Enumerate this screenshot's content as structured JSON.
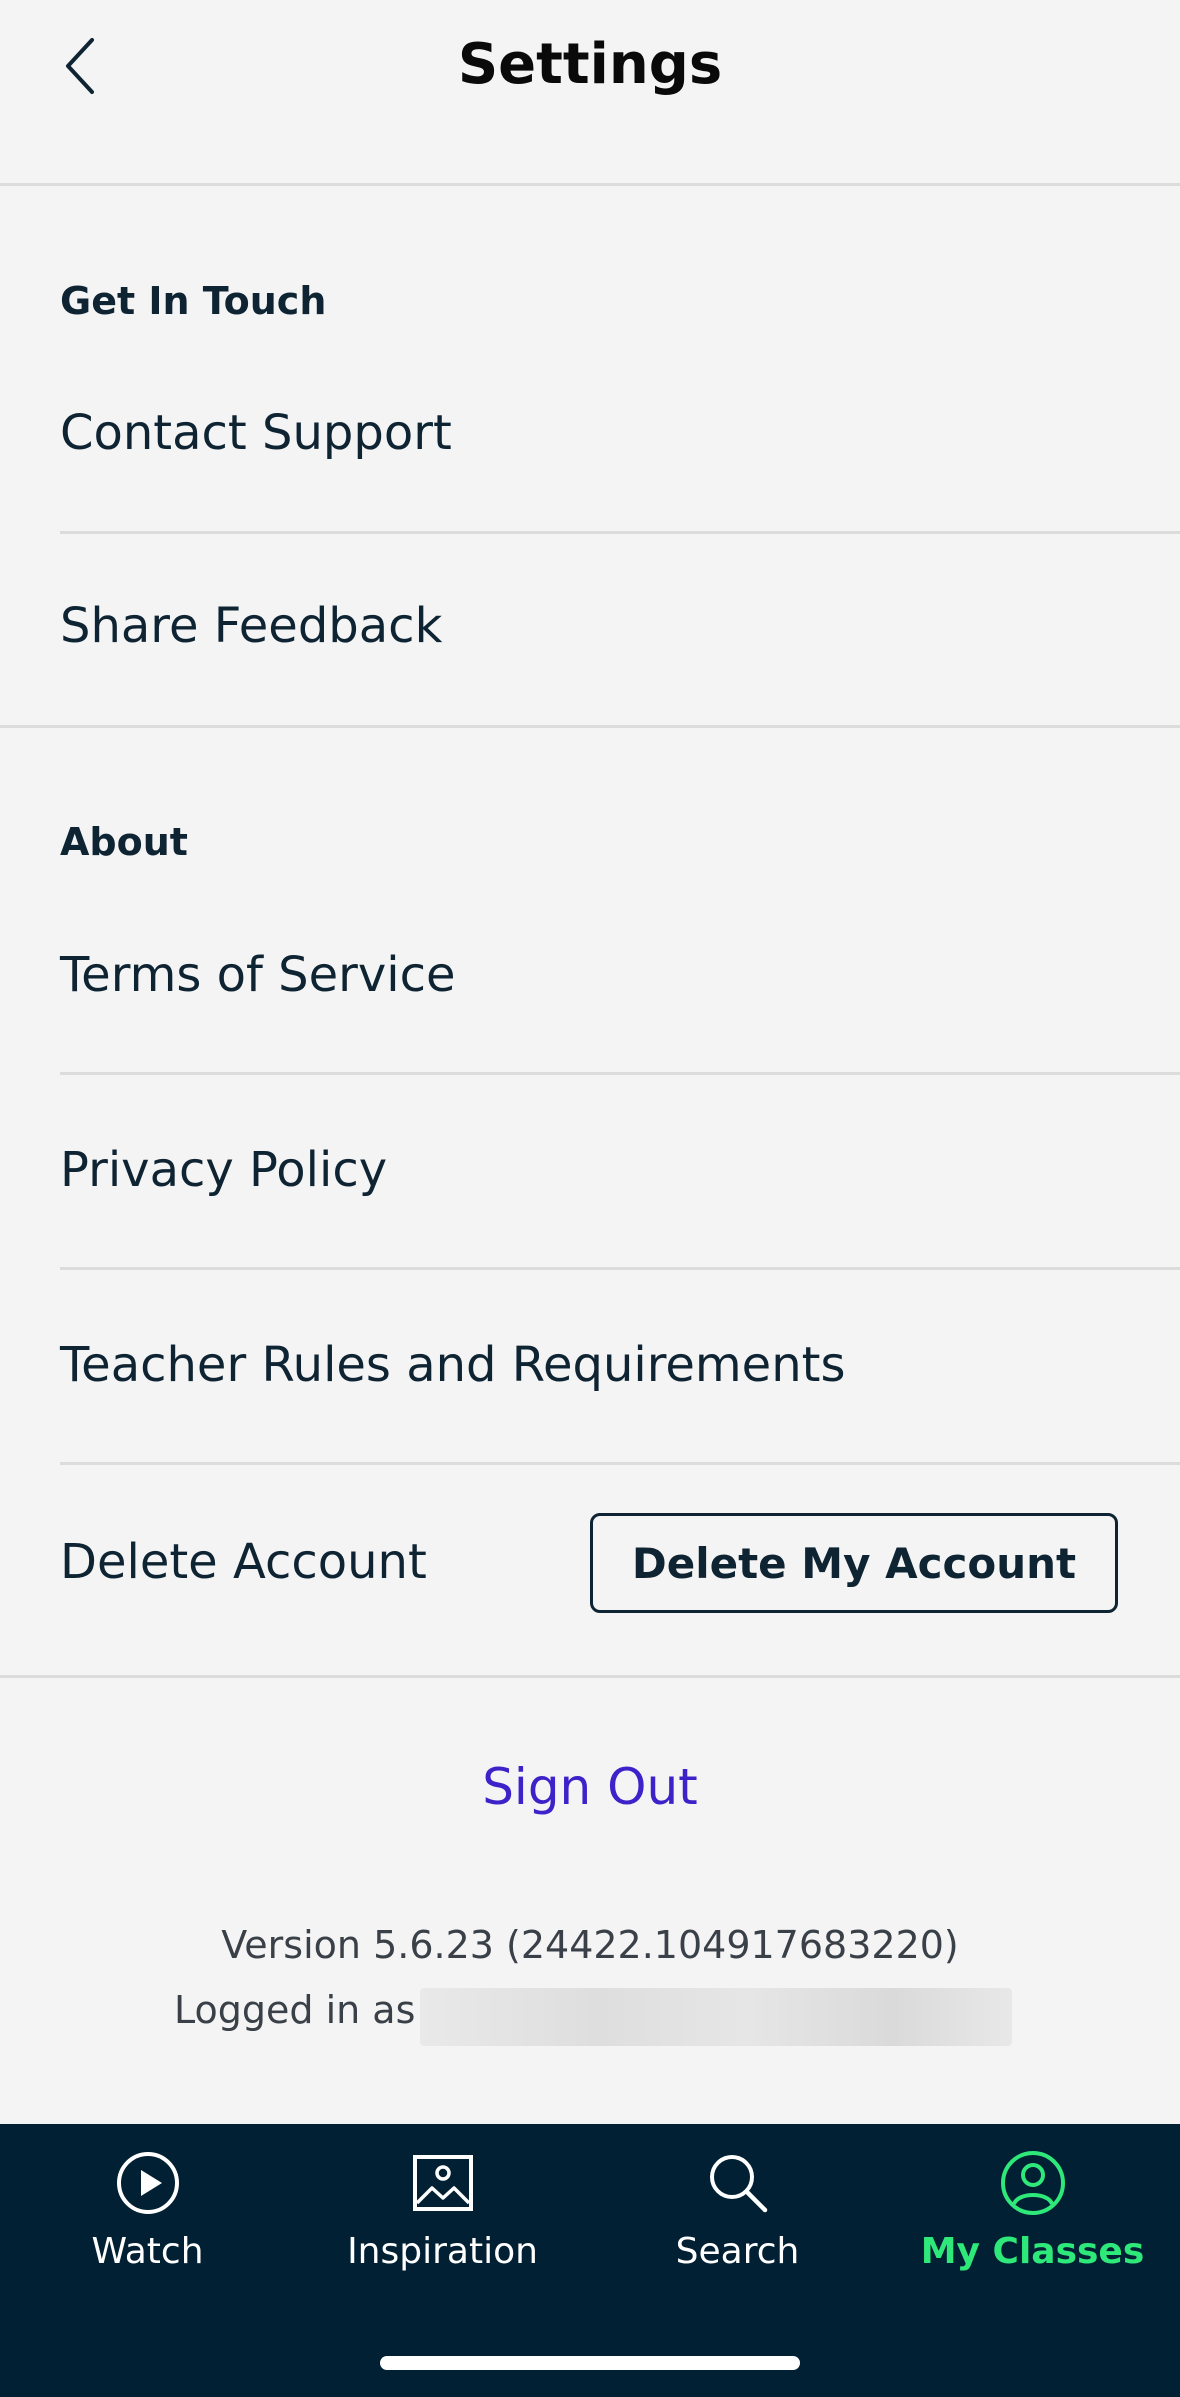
{
  "header": {
    "title": "Settings",
    "back_icon": "chevron-left-icon"
  },
  "sections": {
    "get_in_touch": {
      "title": "Get In Touch",
      "items": [
        {
          "label": "Contact Support"
        },
        {
          "label": "Share Feedback"
        }
      ]
    },
    "about": {
      "title": "About",
      "items": [
        {
          "label": "Terms of Service"
        },
        {
          "label": "Privacy Policy"
        },
        {
          "label": "Teacher Rules and Requirements"
        },
        {
          "label": "Delete Account",
          "button_label": "Delete My Account"
        }
      ]
    }
  },
  "sign_out": {
    "label": "Sign Out",
    "color": "#3d22c9"
  },
  "footer": {
    "version": "Version 5.6.23 (24422.104917683220)",
    "logged_in_label": "Logged in as"
  },
  "tabbar": {
    "background": "#022033",
    "active_color": "#2ee87a",
    "tabs": [
      {
        "label": "Watch",
        "icon": "play-circle-icon",
        "active": false
      },
      {
        "label": "Inspiration",
        "icon": "image-icon",
        "active": false
      },
      {
        "label": "Search",
        "icon": "search-icon",
        "active": false
      },
      {
        "label": "My Classes",
        "icon": "user-circle-icon",
        "active": true
      }
    ]
  }
}
